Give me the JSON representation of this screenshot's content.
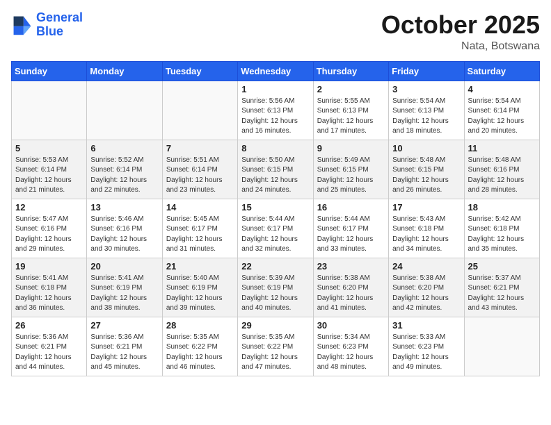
{
  "header": {
    "logo_line1": "General",
    "logo_line2": "Blue",
    "month": "October 2025",
    "location": "Nata, Botswana"
  },
  "weekdays": [
    "Sunday",
    "Monday",
    "Tuesday",
    "Wednesday",
    "Thursday",
    "Friday",
    "Saturday"
  ],
  "weeks": [
    [
      {
        "day": "",
        "info": ""
      },
      {
        "day": "",
        "info": ""
      },
      {
        "day": "",
        "info": ""
      },
      {
        "day": "1",
        "info": "Sunrise: 5:56 AM\nSunset: 6:13 PM\nDaylight: 12 hours\nand 16 minutes."
      },
      {
        "day": "2",
        "info": "Sunrise: 5:55 AM\nSunset: 6:13 PM\nDaylight: 12 hours\nand 17 minutes."
      },
      {
        "day": "3",
        "info": "Sunrise: 5:54 AM\nSunset: 6:13 PM\nDaylight: 12 hours\nand 18 minutes."
      },
      {
        "day": "4",
        "info": "Sunrise: 5:54 AM\nSunset: 6:14 PM\nDaylight: 12 hours\nand 20 minutes."
      }
    ],
    [
      {
        "day": "5",
        "info": "Sunrise: 5:53 AM\nSunset: 6:14 PM\nDaylight: 12 hours\nand 21 minutes."
      },
      {
        "day": "6",
        "info": "Sunrise: 5:52 AM\nSunset: 6:14 PM\nDaylight: 12 hours\nand 22 minutes."
      },
      {
        "day": "7",
        "info": "Sunrise: 5:51 AM\nSunset: 6:14 PM\nDaylight: 12 hours\nand 23 minutes."
      },
      {
        "day": "8",
        "info": "Sunrise: 5:50 AM\nSunset: 6:15 PM\nDaylight: 12 hours\nand 24 minutes."
      },
      {
        "day": "9",
        "info": "Sunrise: 5:49 AM\nSunset: 6:15 PM\nDaylight: 12 hours\nand 25 minutes."
      },
      {
        "day": "10",
        "info": "Sunrise: 5:48 AM\nSunset: 6:15 PM\nDaylight: 12 hours\nand 26 minutes."
      },
      {
        "day": "11",
        "info": "Sunrise: 5:48 AM\nSunset: 6:16 PM\nDaylight: 12 hours\nand 28 minutes."
      }
    ],
    [
      {
        "day": "12",
        "info": "Sunrise: 5:47 AM\nSunset: 6:16 PM\nDaylight: 12 hours\nand 29 minutes."
      },
      {
        "day": "13",
        "info": "Sunrise: 5:46 AM\nSunset: 6:16 PM\nDaylight: 12 hours\nand 30 minutes."
      },
      {
        "day": "14",
        "info": "Sunrise: 5:45 AM\nSunset: 6:17 PM\nDaylight: 12 hours\nand 31 minutes."
      },
      {
        "day": "15",
        "info": "Sunrise: 5:44 AM\nSunset: 6:17 PM\nDaylight: 12 hours\nand 32 minutes."
      },
      {
        "day": "16",
        "info": "Sunrise: 5:44 AM\nSunset: 6:17 PM\nDaylight: 12 hours\nand 33 minutes."
      },
      {
        "day": "17",
        "info": "Sunrise: 5:43 AM\nSunset: 6:18 PM\nDaylight: 12 hours\nand 34 minutes."
      },
      {
        "day": "18",
        "info": "Sunrise: 5:42 AM\nSunset: 6:18 PM\nDaylight: 12 hours\nand 35 minutes."
      }
    ],
    [
      {
        "day": "19",
        "info": "Sunrise: 5:41 AM\nSunset: 6:18 PM\nDaylight: 12 hours\nand 36 minutes."
      },
      {
        "day": "20",
        "info": "Sunrise: 5:41 AM\nSunset: 6:19 PM\nDaylight: 12 hours\nand 38 minutes."
      },
      {
        "day": "21",
        "info": "Sunrise: 5:40 AM\nSunset: 6:19 PM\nDaylight: 12 hours\nand 39 minutes."
      },
      {
        "day": "22",
        "info": "Sunrise: 5:39 AM\nSunset: 6:19 PM\nDaylight: 12 hours\nand 40 minutes."
      },
      {
        "day": "23",
        "info": "Sunrise: 5:38 AM\nSunset: 6:20 PM\nDaylight: 12 hours\nand 41 minutes."
      },
      {
        "day": "24",
        "info": "Sunrise: 5:38 AM\nSunset: 6:20 PM\nDaylight: 12 hours\nand 42 minutes."
      },
      {
        "day": "25",
        "info": "Sunrise: 5:37 AM\nSunset: 6:21 PM\nDaylight: 12 hours\nand 43 minutes."
      }
    ],
    [
      {
        "day": "26",
        "info": "Sunrise: 5:36 AM\nSunset: 6:21 PM\nDaylight: 12 hours\nand 44 minutes."
      },
      {
        "day": "27",
        "info": "Sunrise: 5:36 AM\nSunset: 6:21 PM\nDaylight: 12 hours\nand 45 minutes."
      },
      {
        "day": "28",
        "info": "Sunrise: 5:35 AM\nSunset: 6:22 PM\nDaylight: 12 hours\nand 46 minutes."
      },
      {
        "day": "29",
        "info": "Sunrise: 5:35 AM\nSunset: 6:22 PM\nDaylight: 12 hours\nand 47 minutes."
      },
      {
        "day": "30",
        "info": "Sunrise: 5:34 AM\nSunset: 6:23 PM\nDaylight: 12 hours\nand 48 minutes."
      },
      {
        "day": "31",
        "info": "Sunrise: 5:33 AM\nSunset: 6:23 PM\nDaylight: 12 hours\nand 49 minutes."
      },
      {
        "day": "",
        "info": ""
      }
    ]
  ]
}
